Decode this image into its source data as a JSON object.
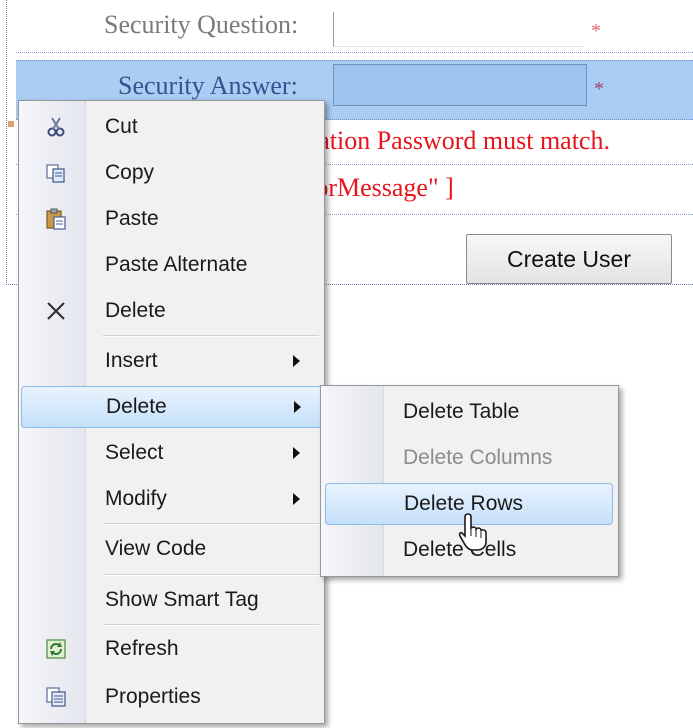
{
  "form": {
    "security_question_label": "Security Question:",
    "security_answer_label": "Security Answer:",
    "required_marker": "*",
    "error_line_1": "mation Password must match.",
    "error_line_2": "rrorMessage\" ]",
    "create_user_button": "Create User"
  },
  "context_menu": {
    "items": [
      {
        "label": "Cut",
        "icon": "scissors-icon"
      },
      {
        "label": "Copy",
        "icon": "copy-icon"
      },
      {
        "label": "Paste",
        "icon": "paste-icon"
      },
      {
        "label": "Paste Alternate"
      },
      {
        "label": "Delete",
        "icon": "delete-x-icon"
      },
      {
        "label": "Insert",
        "submenu": true
      },
      {
        "label": "Delete",
        "submenu": true,
        "highlighted": true
      },
      {
        "label": "Select",
        "submenu": true
      },
      {
        "label": "Modify",
        "submenu": true
      },
      {
        "label": "View Code"
      },
      {
        "label": "Show Smart Tag"
      },
      {
        "label": "Refresh",
        "icon": "refresh-icon"
      },
      {
        "label": "Properties",
        "icon": "properties-icon"
      }
    ]
  },
  "delete_submenu": {
    "items": [
      {
        "label": "Delete Table",
        "enabled": true
      },
      {
        "label": "Delete Columns",
        "enabled": false
      },
      {
        "label": "Delete Rows",
        "enabled": true,
        "highlighted": true
      },
      {
        "label": "Delete Cells",
        "enabled": true
      }
    ]
  },
  "colors": {
    "selection_row": "#a9cdf3",
    "error_text": "#e8141b",
    "menu_background": "#f1f1f1",
    "menu_highlight": "#c5e0fa"
  }
}
